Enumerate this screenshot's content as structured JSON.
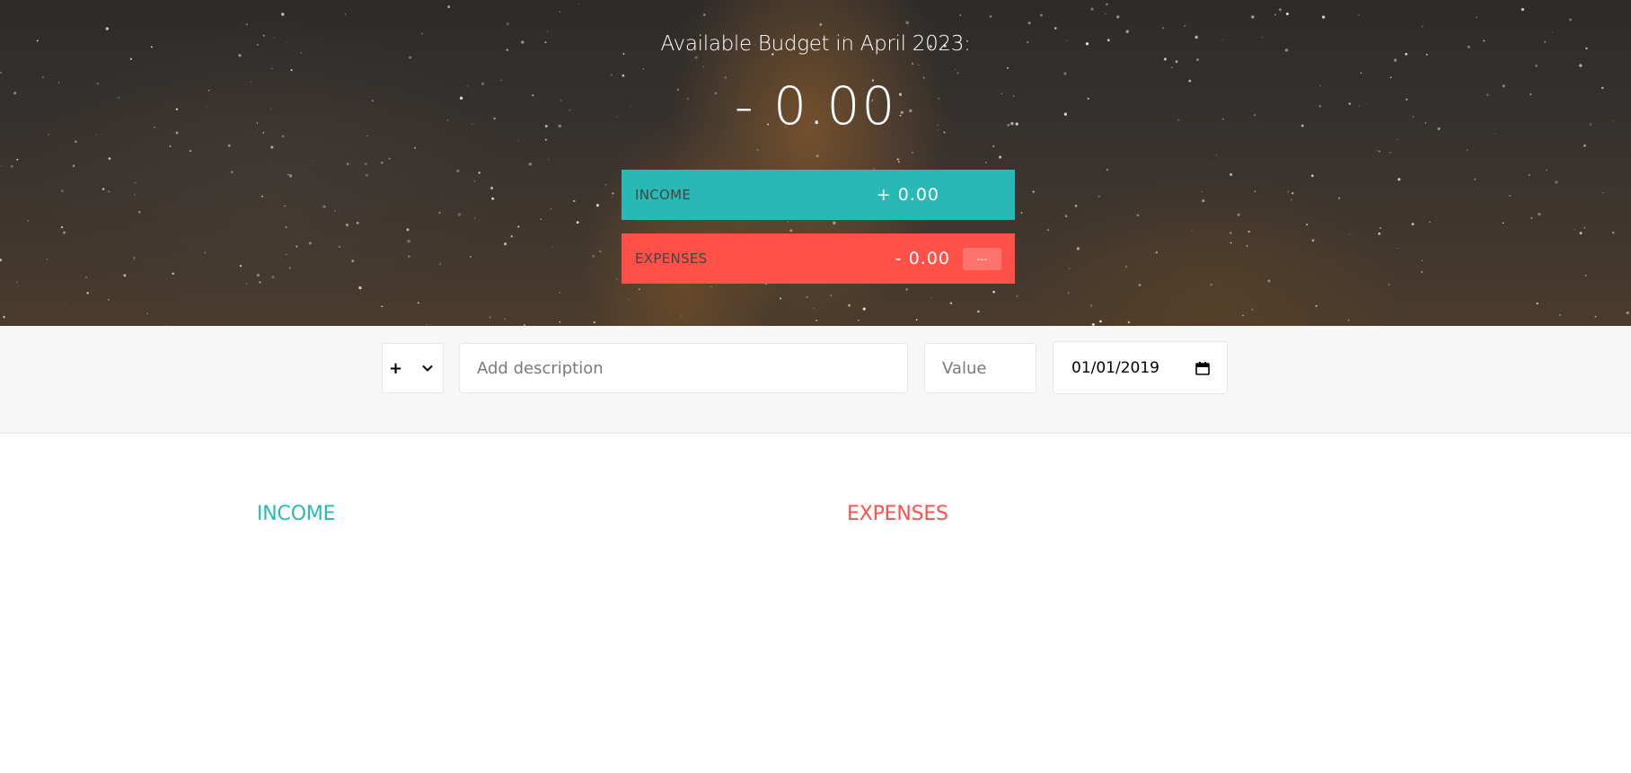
{
  "header": {
    "title": "Available Budget in April 2023:",
    "budget_value": "- 0.00"
  },
  "summary": {
    "income": {
      "label": "INCOME",
      "value": "+ 0.00"
    },
    "expenses": {
      "label": "EXPENSES",
      "value": "- 0.00",
      "percentage": "---"
    }
  },
  "add_form": {
    "type_selected": "+",
    "description_placeholder": "Add description",
    "value_placeholder": "Value",
    "date_value": "01/01/2019"
  },
  "lists": {
    "income_title": "INCOME",
    "expenses_title": "EXPENSES"
  },
  "colors": {
    "income": "#28b9b5",
    "expenses": "#ff5049"
  },
  "icons": {
    "type_dropdown": "chevron-down-icon",
    "date_picker": "calendar-icon"
  }
}
